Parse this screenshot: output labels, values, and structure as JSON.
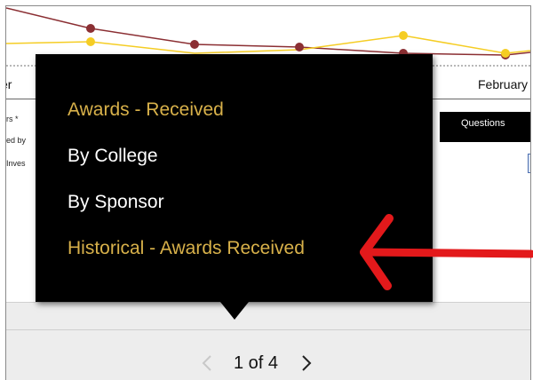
{
  "colors": {
    "menu_highlight": "#d8b14a",
    "menu_normal": "#ffffff",
    "popup_bg": "#000000",
    "arrow": "#e3191b",
    "line_yellow": "#f5cd24",
    "line_maroon": "#8b2f33"
  },
  "chart": {
    "axis_left_label": "er",
    "axis_right_label": "February",
    "legend_fragments": [
      "rs *",
      "ed by",
      "Inves"
    ]
  },
  "report_button": {
    "label": "Questions"
  },
  "menu": {
    "items": [
      {
        "label": "Awards - Received",
        "highlighted": true
      },
      {
        "label": "By College",
        "highlighted": false
      },
      {
        "label": "By Sponsor",
        "highlighted": false
      },
      {
        "label": "Historical - Awards Received",
        "highlighted": true
      }
    ]
  },
  "pager": {
    "text": "1 of 4",
    "prev_icon": "chevron-left-icon",
    "next_icon": "chevron-right-icon"
  },
  "annotation": {
    "icon": "red-arrow-icon"
  }
}
